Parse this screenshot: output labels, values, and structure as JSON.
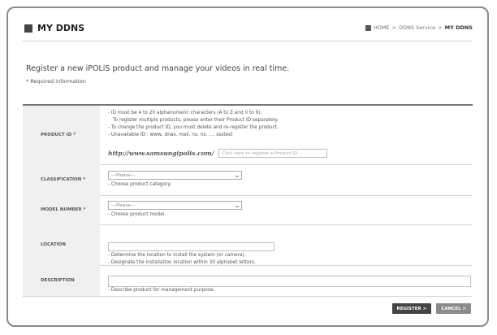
{
  "header": {
    "title": "MY DDNS",
    "breadcrumb": [
      "HOME",
      "DDNS Service",
      "MY DDNS"
    ],
    "breadcrumb_sep": ">"
  },
  "intro": {
    "text": "Register a new iPOLiS product and manage your videos in real time.",
    "required_note": "* Required information"
  },
  "form": {
    "product_id": {
      "label": "PRODUCT ID *",
      "notes": [
        "- ID must be 4 to 20 alphanumeric characters (A to Z and 0 to 9).",
        "To register multiple products, please enter their Product ID separately.",
        "- To change the product ID, you must delete and re-register the product.",
        "- Unavailable ID : www, dnas, mail, ns, ns, .... ssstest"
      ],
      "url_prefix": "http://www.samsungipolis.com/",
      "input_placeholder": "Click here to register a Product ID."
    },
    "classification": {
      "label": "CLASSIFICATION *",
      "selected": "---Please---",
      "hint": "- Choose product category."
    },
    "model_number": {
      "label": "MODEL NUMBER *",
      "selected": "---Please---",
      "hint": "- Choose product model."
    },
    "location": {
      "label": "LOCATION",
      "hints": [
        "- Determine the location to install the system (or camera).",
        "- Designate the installation location within 30 alphabet letters."
      ]
    },
    "description": {
      "label": "DESCRIPTION",
      "hint": "- Describe product for management purpose."
    }
  },
  "buttons": {
    "register": "REGISTER >",
    "cancel": "CANCEL >"
  }
}
